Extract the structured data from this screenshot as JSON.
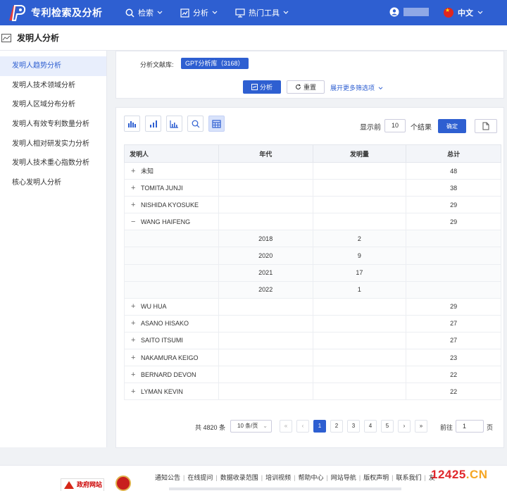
{
  "header": {
    "app_title": "专利检索及分析",
    "nav": [
      {
        "label": "检索",
        "icon": "search-icon"
      },
      {
        "label": "分析",
        "icon": "chart-icon"
      },
      {
        "label": "热门工具",
        "icon": "monitor-icon"
      }
    ],
    "language": "中文"
  },
  "page": {
    "title": "发明人分析"
  },
  "sidebar": {
    "items": [
      {
        "label": "发明人趋势分析",
        "active": true
      },
      {
        "label": "发明人技术领域分析"
      },
      {
        "label": "发明人区域分布分析"
      },
      {
        "label": "发明人有效专利数量分析"
      },
      {
        "label": "发明人相对研发实力分析"
      },
      {
        "label": "发明人技术重心指数分析"
      },
      {
        "label": "核心发明人分析"
      }
    ]
  },
  "filter": {
    "db_label": "分析文献库:",
    "db_tag": "GPT分析库（3168）",
    "analyze_label": "分析",
    "reset_label": "重置",
    "more_label": "展开更多筛选项"
  },
  "toolbar": {
    "show_label": "显示前",
    "show_value": "10",
    "show_unit": "个结果",
    "confirm_label": "确定"
  },
  "table": {
    "columns": [
      "发明人",
      "年代",
      "发明量",
      "总计"
    ],
    "rows": [
      {
        "inventor": "未知",
        "year": "",
        "count": "",
        "total": "48",
        "expanded": false
      },
      {
        "inventor": "TOMITA JUNJI",
        "year": "",
        "count": "",
        "total": "38",
        "expanded": false
      },
      {
        "inventor": "NISHIDA KYOSUKE",
        "year": "",
        "count": "",
        "total": "29",
        "expanded": false
      },
      {
        "inventor": "WANG HAIFENG",
        "year": "",
        "count": "",
        "total": "29",
        "expanded": true
      },
      {
        "child": true,
        "year": "2018",
        "count": "2"
      },
      {
        "child": true,
        "year": "2020",
        "count": "9"
      },
      {
        "child": true,
        "year": "2021",
        "count": "17"
      },
      {
        "child": true,
        "year": "2022",
        "count": "1"
      },
      {
        "inventor": "WU HUA",
        "year": "",
        "count": "",
        "total": "29",
        "expanded": false
      },
      {
        "inventor": "ASANO HISAKO",
        "year": "",
        "count": "",
        "total": "27",
        "expanded": false
      },
      {
        "inventor": "SAITO ITSUMI",
        "year": "",
        "count": "",
        "total": "27",
        "expanded": false
      },
      {
        "inventor": "NAKAMURA KEIGO",
        "year": "",
        "count": "",
        "total": "23",
        "expanded": false
      },
      {
        "inventor": "BERNARD DEVON",
        "year": "",
        "count": "",
        "total": "22",
        "expanded": false
      },
      {
        "inventor": "LYMAN KEVIN",
        "year": "",
        "count": "",
        "total": "22",
        "expanded": false
      }
    ]
  },
  "pagination": {
    "total_prefix": "共",
    "total": "4820",
    "total_suffix": "条",
    "page_size": "10 条/页",
    "pages": [
      "1",
      "2",
      "3",
      "4",
      "5"
    ],
    "current": "1",
    "goto_label": "前往",
    "goto_value": "1",
    "page_suffix": "页"
  },
  "footer": {
    "gov_label": "政府网站",
    "links": [
      "通知公告",
      "在线提问",
      "数据收录范围",
      "培训视频",
      "帮助中心",
      "网站导航",
      "版权声明",
      "联系我们",
      "友"
    ]
  },
  "watermark": {
    "a": "12425",
    "b": ".CN"
  },
  "colors": {
    "primary": "#2e5fd1",
    "active_bg": "#e8eefc"
  }
}
